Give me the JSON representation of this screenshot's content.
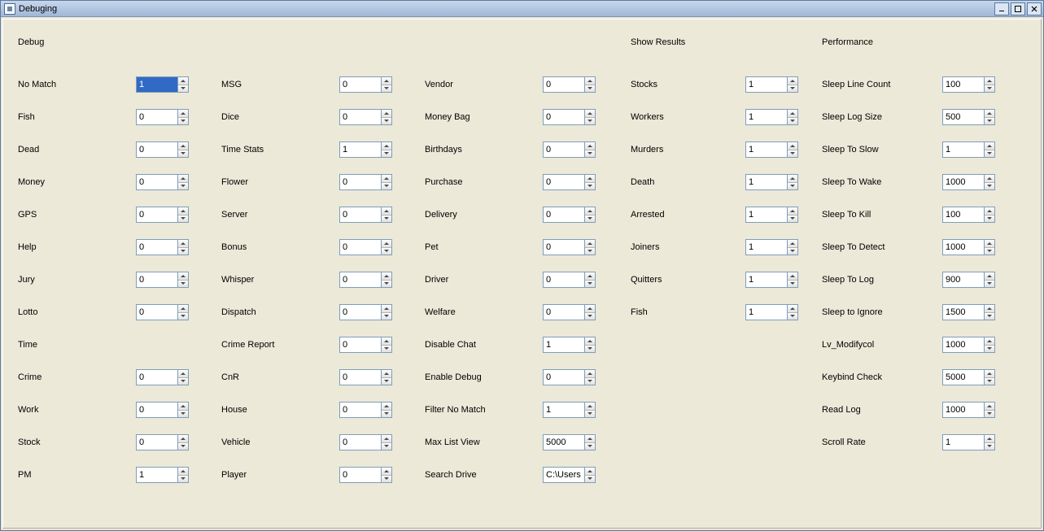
{
  "window": {
    "title": "Debuging"
  },
  "headers": {
    "debug": "Debug",
    "show_results": "Show Results",
    "performance": "Performance"
  },
  "col1": {
    "no_match": {
      "label": "No Match",
      "value": "1"
    },
    "fish": {
      "label": "Fish",
      "value": "0"
    },
    "dead": {
      "label": "Dead",
      "value": "0"
    },
    "money": {
      "label": "Money",
      "value": "0"
    },
    "gps": {
      "label": "GPS",
      "value": "0"
    },
    "help": {
      "label": "Help",
      "value": "0"
    },
    "jury": {
      "label": "Jury",
      "value": "0"
    },
    "lotto": {
      "label": "Lotto",
      "value": "0"
    },
    "time": {
      "label": "Time"
    },
    "crime": {
      "label": "Crime",
      "value": "0"
    },
    "work": {
      "label": "Work",
      "value": "0"
    },
    "stock": {
      "label": "Stock",
      "value": "0"
    },
    "pm": {
      "label": "PM",
      "value": "1"
    }
  },
  "col2": {
    "msg": {
      "label": "MSG",
      "value": "0"
    },
    "dice": {
      "label": "Dice",
      "value": "0"
    },
    "time_stats": {
      "label": "Time Stats",
      "value": "1"
    },
    "flower": {
      "label": "Flower",
      "value": "0"
    },
    "server": {
      "label": "Server",
      "value": "0"
    },
    "bonus": {
      "label": "Bonus",
      "value": "0"
    },
    "whisper": {
      "label": "Whisper",
      "value": "0"
    },
    "dispatch": {
      "label": "Dispatch",
      "value": "0"
    },
    "crime_report": {
      "label": "Crime Report",
      "value": "0"
    },
    "cnr": {
      "label": "CnR",
      "value": "0"
    },
    "house": {
      "label": "House",
      "value": "0"
    },
    "vehicle": {
      "label": "Vehicle",
      "value": "0"
    },
    "player": {
      "label": "Player",
      "value": "0"
    }
  },
  "col3": {
    "vendor": {
      "label": "Vendor",
      "value": "0"
    },
    "money_bag": {
      "label": "Money Bag",
      "value": "0"
    },
    "birthdays": {
      "label": "Birthdays",
      "value": "0"
    },
    "purchase": {
      "label": "Purchase",
      "value": "0"
    },
    "delivery": {
      "label": "Delivery",
      "value": "0"
    },
    "pet": {
      "label": "Pet",
      "value": "0"
    },
    "driver": {
      "label": "Driver",
      "value": "0"
    },
    "welfare": {
      "label": "Welfare",
      "value": "0"
    },
    "disable_chat": {
      "label": "Disable Chat",
      "value": "1"
    },
    "enable_debug": {
      "label": "Enable Debug",
      "value": "0"
    },
    "filter_no_match": {
      "label": "Filter No Match",
      "value": "1"
    },
    "max_list_view": {
      "label": "Max List View",
      "value": "5000"
    },
    "search_drive": {
      "label": "Search Drive",
      "value": "C:\\Users"
    }
  },
  "col4": {
    "stocks": {
      "label": "Stocks",
      "value": "1"
    },
    "workers": {
      "label": "Workers",
      "value": "1"
    },
    "murders": {
      "label": "Murders",
      "value": "1"
    },
    "death": {
      "label": "Death",
      "value": "1"
    },
    "arrested": {
      "label": "Arrested",
      "value": "1"
    },
    "joiners": {
      "label": "Joiners",
      "value": "1"
    },
    "quitters": {
      "label": "Quitters",
      "value": "1"
    },
    "fish": {
      "label": "Fish",
      "value": "1"
    }
  },
  "col5": {
    "sleep_line_count": {
      "label": "Sleep Line Count",
      "value": "100"
    },
    "sleep_log_size": {
      "label": "Sleep Log Size",
      "value": "500"
    },
    "sleep_to_slow": {
      "label": "Sleep To Slow",
      "value": "1"
    },
    "sleep_to_wake": {
      "label": "Sleep To Wake",
      "value": "1000"
    },
    "sleep_to_kill": {
      "label": "Sleep To Kill",
      "value": "100"
    },
    "sleep_to_detect": {
      "label": "Sleep To Detect",
      "value": "1000"
    },
    "sleep_to_log": {
      "label": "Sleep To Log",
      "value": "900"
    },
    "sleep_to_ignore": {
      "label": "Sleep to Ignore",
      "value": "1500"
    },
    "lv_modifycol": {
      "label": "Lv_Modifycol",
      "value": "1000"
    },
    "keybind_check": {
      "label": "Keybind Check",
      "value": "5000"
    },
    "read_log": {
      "label": "Read Log",
      "value": "1000"
    },
    "scroll_rate": {
      "label": "Scroll Rate",
      "value": "1"
    }
  }
}
